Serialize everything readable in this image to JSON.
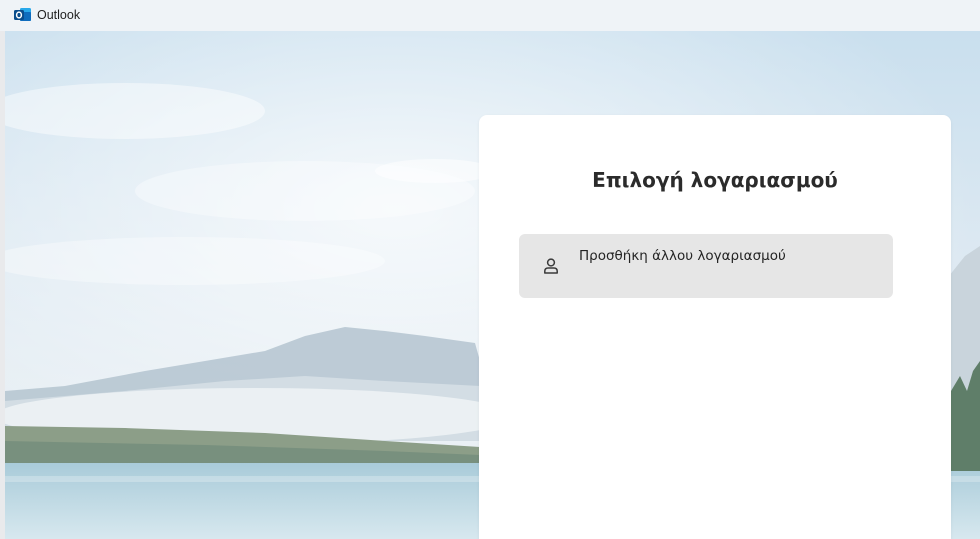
{
  "window": {
    "title": "Outlook",
    "icon": "outlook-icon"
  },
  "dialog": {
    "title": "Επιλογή λογαριασμού",
    "options": [
      {
        "label": "Προσθήκη άλλου λογαριασμού",
        "icon": "person-icon"
      }
    ]
  },
  "colors": {
    "brand": "#0f6cbd",
    "card": "#ffffff",
    "option_bg": "#e6e6e6"
  }
}
